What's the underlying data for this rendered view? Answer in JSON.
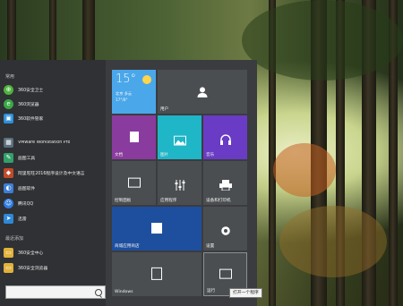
{
  "start_menu": {
    "left_section_title": "常用",
    "apps": [
      {
        "label": "360安全卫士",
        "icon": "360-guard-icon",
        "color": "#4db33d"
      },
      {
        "label": "360浏览器",
        "icon": "360-browser-icon",
        "color": "#39a845"
      },
      {
        "label": "360软件管家",
        "icon": "360-software-icon",
        "color": "#2c8fdc"
      },
      {
        "label": "VMware Workstation Pro",
        "icon": "vmware-icon",
        "color": "#5a6f7e"
      },
      {
        "label": "画图工具",
        "icon": "paint-icon",
        "color": "#32a06a"
      },
      {
        "label": "阿里旺旺2016程序设计及中文语言",
        "icon": "ali-wangwang-icon",
        "color": "#c24a2a"
      },
      {
        "label": "画图软件",
        "icon": "drawing-app-icon",
        "color": "#3d7ed6"
      },
      {
        "label": "腾讯QQ",
        "icon": "qq-icon",
        "color": "#2f7de1"
      },
      {
        "label": "迅雷",
        "icon": "xunlei-icon",
        "color": "#2e88d9"
      }
    ],
    "recent_section_title": "最近添加",
    "recent_apps": [
      {
        "label": "360安全中心",
        "icon": "folder-icon",
        "color": "#e2b13b"
      },
      {
        "label": "360安全浏览器",
        "icon": "folder-icon",
        "color": "#e2b13b"
      }
    ],
    "search_placeholder": ""
  },
  "tiles": {
    "weather": {
      "temp": "15°",
      "line1": "北京  多云",
      "line2": "17°/8°"
    },
    "user": {
      "label": "用户"
    },
    "document": {
      "label": "文档"
    },
    "pictures": {
      "label": "图片"
    },
    "music": {
      "label": "音乐"
    },
    "control_panel": {
      "label": "控制面板"
    },
    "mixer": {
      "label": "应用程序"
    },
    "devices": {
      "label": "设备和打印机"
    },
    "store": {
      "label": "商城应用商店"
    },
    "settings": {
      "label": "设置"
    },
    "windows": {
      "label": "Windows"
    },
    "run": {
      "label": "运行"
    }
  },
  "tooltip": {
    "text": "打开一个程序"
  },
  "colors": {
    "menu_bg": "#3a3c3f",
    "weather_tile": "#4aa7ea",
    "purple_tile": "#8a3b9e",
    "teal_tile": "#1fb6c7",
    "violet_tile": "#6a3bc4",
    "blue_tile": "#1e4f9f",
    "gray_tile": "#4b4e51"
  }
}
